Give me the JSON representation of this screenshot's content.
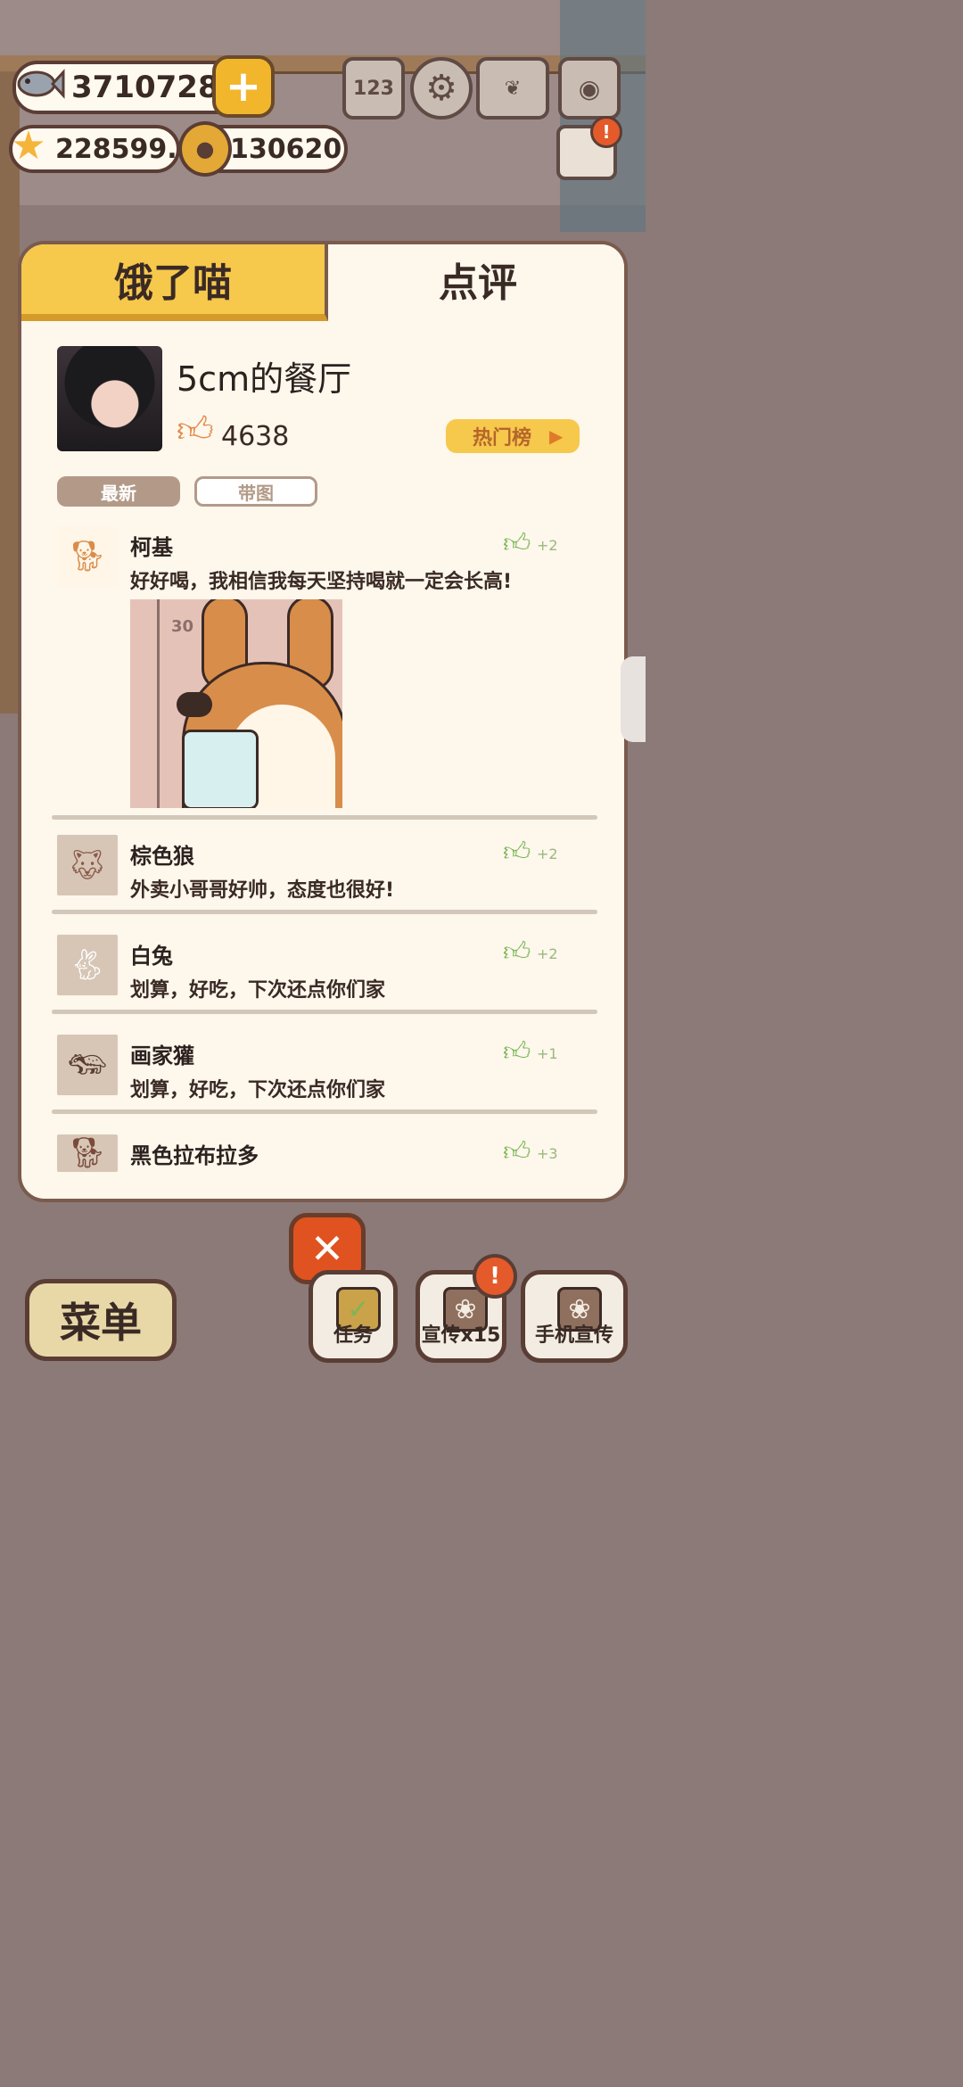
{
  "resources": {
    "fish": "37107285",
    "stars": "228599.6",
    "bells": "130620"
  },
  "top_icons": {
    "rank": "123"
  },
  "tabs": [
    {
      "label": "饿了喵"
    },
    {
      "label": "点评"
    }
  ],
  "restaurant": {
    "name": "5cm的餐厅",
    "likes": "4638",
    "hot_button": "热门榜"
  },
  "filters": {
    "latest": "最新",
    "with_image": "带图"
  },
  "reviews": [
    {
      "name": "柯基",
      "text": "好好喝，我相信我每天坚持喝就一定会长高!",
      "plus": "+2",
      "photo_label": "30"
    },
    {
      "name": "棕色狼",
      "text": "外卖小哥哥好帅，态度也很好!",
      "plus": "+2"
    },
    {
      "name": "白兔",
      "text": "划算，好吃，下次还点你们家",
      "plus": "+2"
    },
    {
      "name": "画家獾",
      "text": "划算，好吃，下次还点你们家",
      "plus": "+1"
    },
    {
      "name": "黑色拉布拉多",
      "text": "",
      "plus": "+3"
    }
  ],
  "bottom": {
    "menu": "菜单",
    "task": "任务",
    "promo": "宣传x15",
    "phone_promo": "手机宣传"
  },
  "colors": {
    "accent_yellow": "#f6c84c",
    "like_green": "#7bb657",
    "close_red": "#e0521f"
  }
}
